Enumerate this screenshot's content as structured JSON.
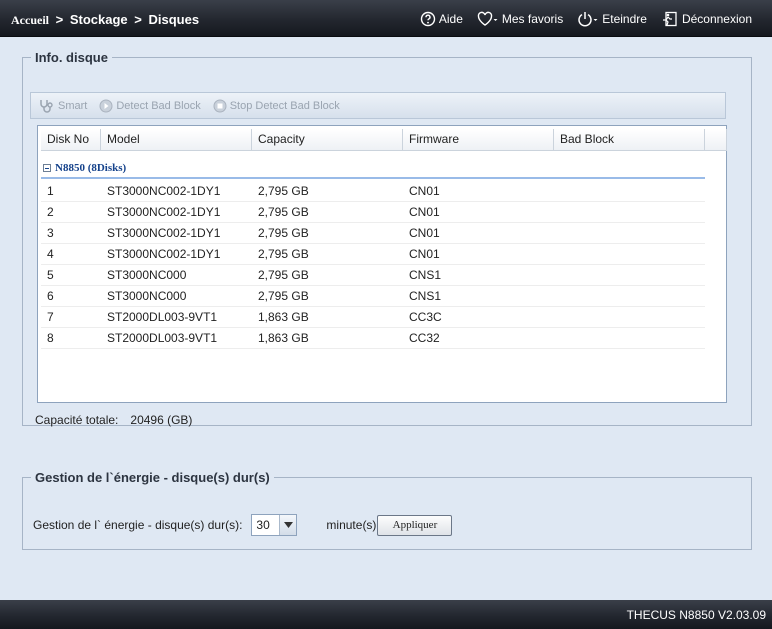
{
  "header": {
    "breadcrumb": {
      "home": "Accueil",
      "sep1": ">",
      "section": "Stockage",
      "sep2": ">",
      "page": "Disques"
    },
    "nav": {
      "help": "Aide",
      "favorites": "Mes favoris",
      "shutdown": "Eteindre",
      "logout": "Déconnexion"
    }
  },
  "disk_info": {
    "legend": "Info. disque",
    "toolbar": {
      "smart": "Smart",
      "detect_bad_block": "Detect Bad Block",
      "stop_detect_bad_block": "Stop Detect Bad Block"
    },
    "columns": [
      "Disk No",
      "Model",
      "Capacity",
      "Firmware",
      "Bad Block"
    ],
    "group_label": "N8850 (8Disks)",
    "rows": [
      {
        "no": "1",
        "model": "ST3000NC002-1DY1",
        "capacity": "2,795 GB",
        "firmware": "CN01",
        "bad_block": ""
      },
      {
        "no": "2",
        "model": "ST3000NC002-1DY1",
        "capacity": "2,795 GB",
        "firmware": "CN01",
        "bad_block": ""
      },
      {
        "no": "3",
        "model": "ST3000NC002-1DY1",
        "capacity": "2,795 GB",
        "firmware": "CN01",
        "bad_block": ""
      },
      {
        "no": "4",
        "model": "ST3000NC002-1DY1",
        "capacity": "2,795 GB",
        "firmware": "CN01",
        "bad_block": ""
      },
      {
        "no": "5",
        "model": "ST3000NC000",
        "capacity": "2,795 GB",
        "firmware": "CNS1",
        "bad_block": ""
      },
      {
        "no": "6",
        "model": "ST3000NC000",
        "capacity": "2,795 GB",
        "firmware": "CNS1",
        "bad_block": ""
      },
      {
        "no": "7",
        "model": "ST2000DL003-9VT1",
        "capacity": "1,863 GB",
        "firmware": "CC3C",
        "bad_block": ""
      },
      {
        "no": "8",
        "model": "ST2000DL003-9VT1",
        "capacity": "1,863 GB",
        "firmware": "CC32",
        "bad_block": ""
      }
    ],
    "total_label": "Capacité totale:",
    "total_value": "20496 (GB)"
  },
  "power": {
    "legend": "Gestion de l`énergie - disque(s) dur(s)",
    "label": "Gestion de l` énergie - disque(s) dur(s):",
    "selected": "30",
    "unit": "minute(s)",
    "apply": "Appliquer"
  },
  "footer": {
    "version": "THECUS N8850 V2.03.09"
  },
  "colors": {
    "topbar": "#23272f",
    "background": "#dfe8f3",
    "group_text": "#15428b",
    "disabled": "#9aa4b0"
  }
}
